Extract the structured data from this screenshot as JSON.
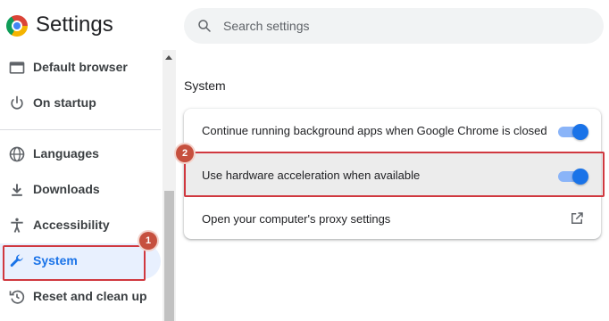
{
  "header": {
    "app_title": "Settings",
    "logo_icon": "chrome-logo-icon"
  },
  "search": {
    "placeholder": "Search settings",
    "value": "",
    "icon": "search-icon"
  },
  "sidebar": {
    "items": [
      {
        "label": "Default browser",
        "icon": "browser-window-icon"
      },
      {
        "label": "On startup",
        "icon": "power-icon"
      },
      {
        "label": "Languages",
        "icon": "globe-icon"
      },
      {
        "label": "Downloads",
        "icon": "download-icon"
      },
      {
        "label": "Accessibility",
        "icon": "accessibility-icon"
      },
      {
        "label": "System",
        "icon": "wrench-icon",
        "active": true
      },
      {
        "label": "Reset and clean up",
        "icon": "reset-icon"
      }
    ]
  },
  "main": {
    "section_title": "System",
    "rows": [
      {
        "label": "Continue running background apps when Google Chrome is closed",
        "control": "toggle",
        "on": true
      },
      {
        "label": "Use hardware acceleration when available",
        "control": "toggle",
        "on": true
      },
      {
        "label": "Open your computer's proxy settings",
        "control": "external-link-icon"
      }
    ]
  },
  "annotations": [
    {
      "number": "1",
      "target": "System"
    },
    {
      "number": "2",
      "target": "Use hardware acceleration when available"
    }
  ],
  "colors": {
    "accent": "#1a73e8",
    "toggle_track": "#8ab4f8",
    "callout": "#d0383f",
    "badge": "#c6503e"
  }
}
